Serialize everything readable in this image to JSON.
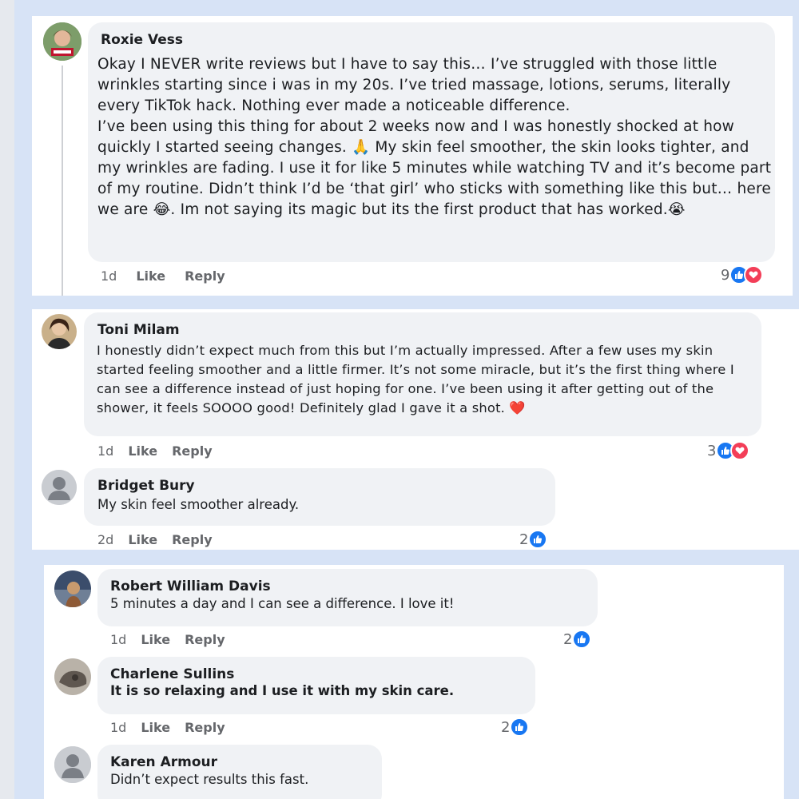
{
  "comments": [
    {
      "name": "Roxie Vess",
      "text": "Okay I NEVER write reviews but I have to say this… I’ve struggled with those little wrinkles starting since i was in my 20s. I’ve tried massage, lotions, serums, literally every TikTok hack. Nothing ever made a noticeable difference.\nI’ve been using this thing for about 2 weeks now and I was honestly shocked at how quickly I started seeing changes. 🙏 My skin feel smoother, the skin looks tighter, and my wrinkles are fading. I use it for like 5 minutes while watching TV and it’s become part of my routine. Didn’t think I’d be ‘that girl’ who sticks with something like this but… here we are 😂. Im not saying its magic but its the first product that has worked.😭",
      "time": "1d",
      "like": "Like",
      "reply": "Reply",
      "reactions": "9"
    },
    {
      "name": "Toni Milam",
      "text": "I honestly didn’t expect much from this but I’m actually impressed. After a few uses my skin started feeling smoother and a little firmer. It’s not some  miracle, but it’s the first thing where I can see a difference instead of just hoping for one. I’ve been using it after getting out of the shower, it feels SOOOO good! Definitely glad I gave it a shot. ❤️",
      "time": "1d",
      "like": "Like",
      "reply": "Reply",
      "reactions": "3"
    },
    {
      "name": "Bridget Bury",
      "text": "My skin feel smoother already.",
      "time": "2d",
      "like": "Like",
      "reply": "Reply",
      "reactions": "2"
    },
    {
      "name": "Robert William Davis",
      "text": "5 minutes a day and I can see a difference. I love it!",
      "time": "1d",
      "like": "Like",
      "reply": "Reply",
      "reactions": "2"
    },
    {
      "name": "Charlene Sullins",
      "text": "It is so relaxing and I use it with my skin care.",
      "time": "1d",
      "like": "Like",
      "reply": "Reply",
      "reactions": "2"
    },
    {
      "name": "Karen Armour",
      "text": "Didn’t expect results this fast."
    }
  ],
  "colors": {
    "like_blue": "#1877f2",
    "love_red": "#f33e58",
    "bubble_gray": "#f0f2f5",
    "meta_gray": "#65676b",
    "background_blue": "#d7e3f6"
  }
}
